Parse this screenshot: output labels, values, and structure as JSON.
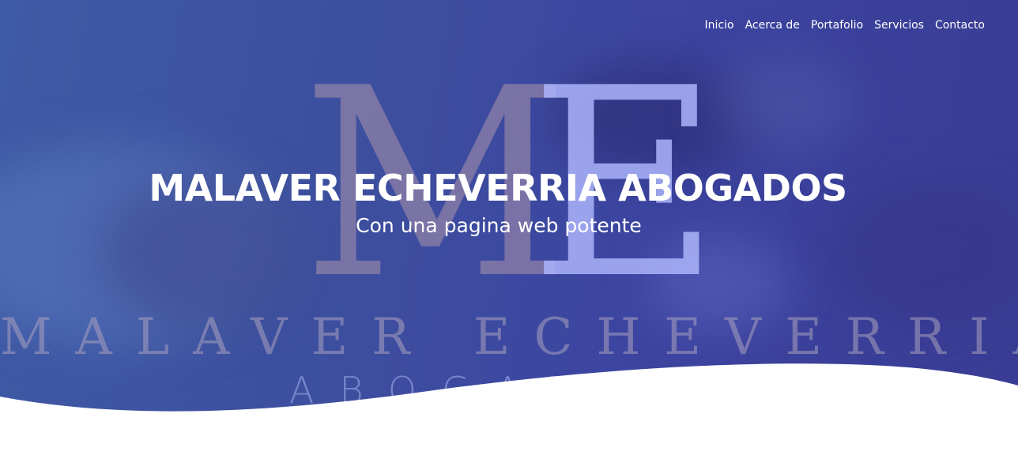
{
  "nav": {
    "items": [
      {
        "label": "Inicio"
      },
      {
        "label": "Acerca de"
      },
      {
        "label": "Portafolio"
      },
      {
        "label": "Servicios"
      },
      {
        "label": "Contacto"
      }
    ]
  },
  "hero": {
    "title": "MALAVER ECHEVERRIA ABOGADOS",
    "subtitle": "Con una pagina web potente",
    "background_logo": {
      "initial_m": "M",
      "initial_e": "E",
      "name": "MALAVER ECHEVERRIA",
      "sub": "ABOGADOS"
    }
  },
  "colors": {
    "hero_gradient_start": "#3f5aa6",
    "hero_gradient_end": "#393c93",
    "text": "#ffffff",
    "page_background": "#ffffff"
  }
}
